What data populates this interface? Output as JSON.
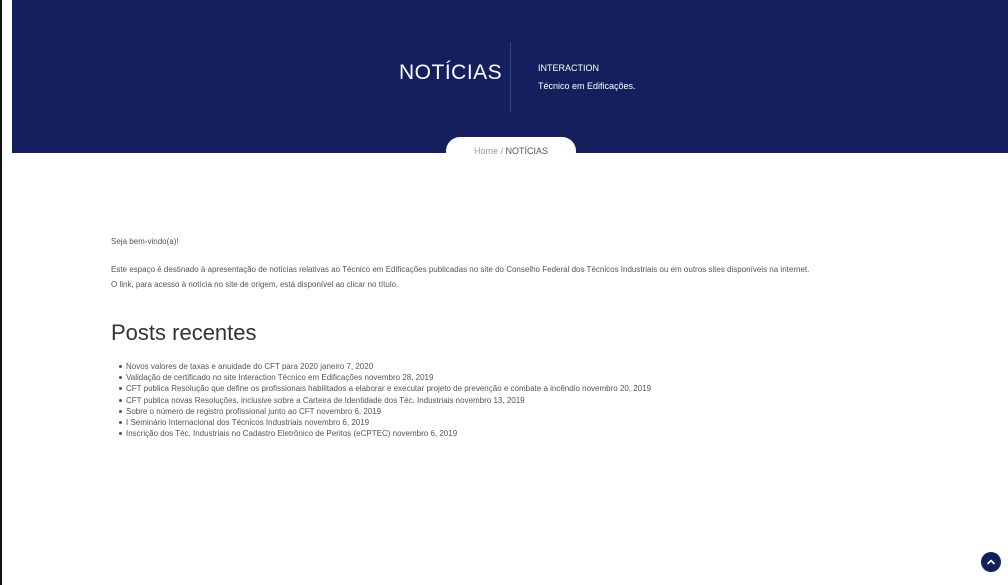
{
  "header": {
    "title": "NOTÍCIAS",
    "subtitle_line1": "INTERACTION",
    "subtitle_line2": "Técnico em Edificações."
  },
  "breadcrumb": {
    "home": "Home",
    "separator": " / ",
    "current": "NOTÍCIAS"
  },
  "intro": {
    "welcome": "Seja bem-vindo(a)!",
    "line1": "Este espaço é destinado à apresentação de notícias relativas ao Técnico em Edificações publicadas no site do Conselho Federal dos Técnicos Industriais ou em outros sites disponíveis na internet.",
    "line2": "O link, para acesso à notícia no site de origem, está disponível ao clicar no título."
  },
  "posts": {
    "heading": "Posts recentes",
    "items": [
      {
        "title": "Novos valores de taxas e anuidade do CFT para 2020",
        "date": "janeiro 7, 2020"
      },
      {
        "title": "Validação de certificado no site Interaction Técnico em Edificações",
        "date": "novembro 28, 2019"
      },
      {
        "title": "CFT publica Resolução que define os profissionais habilitados a elaborar e executar projeto de prevenção e combate a incêndio",
        "date": "novembro 20, 2019"
      },
      {
        "title": "CFT publica novas Resoluções, inclusive sobre a Carteira de Identidade dos Téc. Industriais",
        "date": "novembro 13, 2019"
      },
      {
        "title": "Sobre o número de registro profissional junto ao CFT",
        "date": "novembro 6, 2019"
      },
      {
        "title": "I Seminário Internacional dos Técnicos Industriais",
        "date": "novembro 6, 2019"
      },
      {
        "title": "Inscrição dos Téc. Industriais no Cadastro Eletrônico de Peritos (eCPTEC)",
        "date": "novembro 6, 2019"
      }
    ]
  },
  "colors": {
    "brand_navy": "#14205e",
    "text_gray": "#555555"
  },
  "icons": {
    "scroll_top": "chevron-up-icon"
  }
}
